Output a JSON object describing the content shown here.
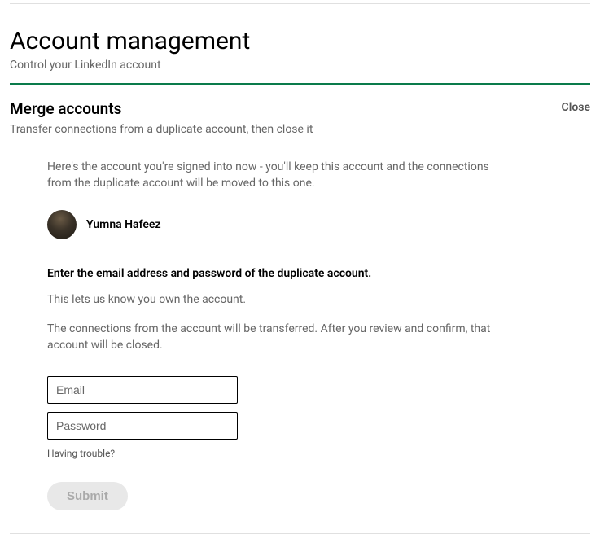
{
  "header": {
    "title": "Account management",
    "subtitle": "Control your LinkedIn account"
  },
  "section": {
    "title": "Merge accounts",
    "close_label": "Close",
    "subtitle": "Transfer connections from a duplicate account, then close it"
  },
  "intro": "Here's the account you're signed into now - you'll keep this account and the connections from the duplicate account will be moved to this one.",
  "account": {
    "name": "Yumna Hafeez"
  },
  "instructions": {
    "bold": "Enter the email address and password of the duplicate account.",
    "line1": "This lets us know you own the account.",
    "line2": "The connections from the account will be transferred. After you review and confirm, that account will be closed."
  },
  "form": {
    "email_placeholder": "Email",
    "password_placeholder": "Password",
    "trouble_link": "Having trouble?",
    "submit_label": "Submit"
  }
}
